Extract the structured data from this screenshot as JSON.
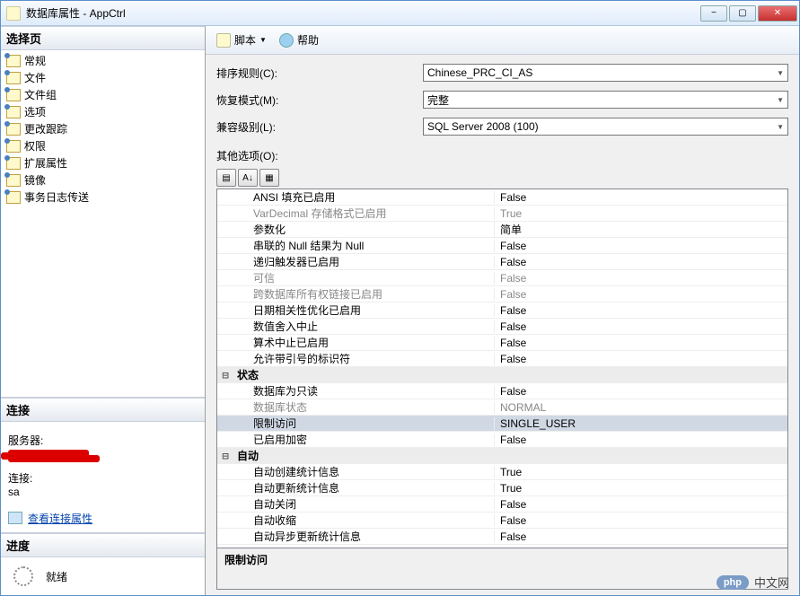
{
  "title": "数据库属性 - AppCtrl",
  "window_buttons": {
    "min": "−",
    "max": "▢",
    "close": "✕"
  },
  "left": {
    "select_page_header": "选择页",
    "pages": [
      "常规",
      "文件",
      "文件组",
      "选项",
      "更改跟踪",
      "权限",
      "扩展属性",
      "镜像",
      "事务日志传送"
    ],
    "connection_header": "连接",
    "server_label": "服务器:",
    "connection_label": "连接:",
    "connection_value": "sa",
    "view_props_link": "查看连接属性",
    "progress_header": "进度",
    "progress_status": "就绪"
  },
  "toolbar": {
    "script": "脚本",
    "help": "帮助"
  },
  "form": {
    "collation_label": "排序规则(C):",
    "collation_value": "Chinese_PRC_CI_AS",
    "recovery_label": "恢复模式(M):",
    "recovery_value": "完整",
    "compat_label": "兼容级别(L):",
    "compat_value": "SQL Server 2008 (100)",
    "other_label": "其他选项(O):"
  },
  "grid_toolbar": {
    "categorized": "▤",
    "az": "A↓",
    "props": "▦"
  },
  "properties": [
    {
      "type": "row",
      "name": "ANSI 填充已启用",
      "value": "False"
    },
    {
      "type": "row",
      "name": "VarDecimal 存储格式已启用",
      "value": "True",
      "disabled": true
    },
    {
      "type": "row",
      "name": "参数化",
      "value": "简单"
    },
    {
      "type": "row",
      "name": "串联的 Null 结果为 Null",
      "value": "False"
    },
    {
      "type": "row",
      "name": "递归触发器已启用",
      "value": "False"
    },
    {
      "type": "row",
      "name": "可信",
      "value": "False",
      "disabled": true
    },
    {
      "type": "row",
      "name": "跨数据库所有权链接已启用",
      "value": "False",
      "disabled": true
    },
    {
      "type": "row",
      "name": "日期相关性优化已启用",
      "value": "False"
    },
    {
      "type": "row",
      "name": "数值舍入中止",
      "value": "False"
    },
    {
      "type": "row",
      "name": "算术中止已启用",
      "value": "False"
    },
    {
      "type": "row",
      "name": "允许带引号的标识符",
      "value": "False"
    },
    {
      "type": "category",
      "name": "状态"
    },
    {
      "type": "row",
      "name": "数据库为只读",
      "value": "False"
    },
    {
      "type": "row",
      "name": "数据库状态",
      "value": "NORMAL",
      "disabled": true
    },
    {
      "type": "row",
      "name": "限制访问",
      "value": "SINGLE_USER",
      "selected": true
    },
    {
      "type": "row",
      "name": "已启用加密",
      "value": "False"
    },
    {
      "type": "category",
      "name": "自动"
    },
    {
      "type": "row",
      "name": "自动创建统计信息",
      "value": "True"
    },
    {
      "type": "row",
      "name": "自动更新统计信息",
      "value": "True"
    },
    {
      "type": "row",
      "name": "自动关闭",
      "value": "False"
    },
    {
      "type": "row",
      "name": "自动收缩",
      "value": "False"
    },
    {
      "type": "row",
      "name": "自动异步更新统计信息",
      "value": "False"
    }
  ],
  "desc_title": "限制访问",
  "watermark": {
    "badge": "php",
    "text": "中文网"
  }
}
